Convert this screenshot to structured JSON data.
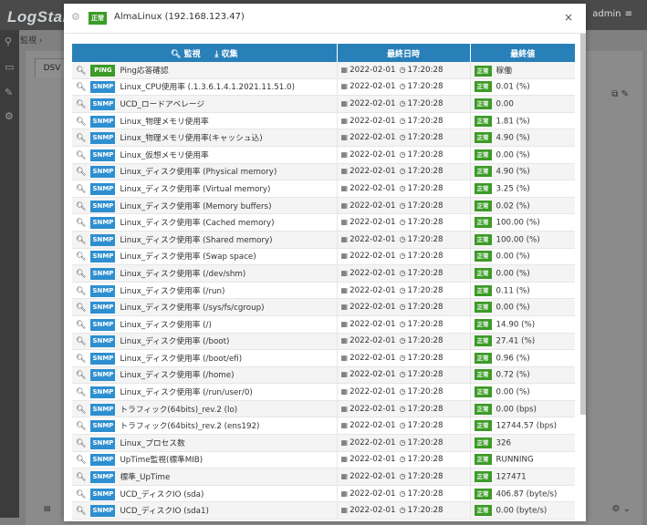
{
  "app": {
    "logo": "LogStar",
    "user": "admin",
    "breadcrumb": "監視 ›",
    "tab": "DSV"
  },
  "modal": {
    "status_badge": "正常",
    "title": "AlmaLinux (192.168.123.47)",
    "close": "×",
    "columns": {
      "monitor": "監視",
      "collect": "収集",
      "last_time": "最終日時",
      "last_value": "最終値"
    },
    "rows": [
      {
        "type": "PING",
        "name": "Ping応答確認",
        "date": "2022-02-01",
        "time": "17:20:28",
        "status": "正常",
        "value": "稼働"
      },
      {
        "type": "SNMP",
        "name": "Linux_CPU使用率 (.1.3.6.1.4.1.2021.11.51.0)",
        "date": "2022-02-01",
        "time": "17:20:28",
        "status": "正常",
        "value": "0.01 (%)"
      },
      {
        "type": "SNMP",
        "name": "UCD_ロードアベレージ",
        "date": "2022-02-01",
        "time": "17:20:28",
        "status": "正常",
        "value": "0.00"
      },
      {
        "type": "SNMP",
        "name": "Linux_物理メモリ使用率",
        "date": "2022-02-01",
        "time": "17:20:28",
        "status": "正常",
        "value": "1.81 (%)"
      },
      {
        "type": "SNMP",
        "name": "Linux_物理メモリ使用率(キャッシュ込)",
        "date": "2022-02-01",
        "time": "17:20:28",
        "status": "正常",
        "value": "4.90 (%)"
      },
      {
        "type": "SNMP",
        "name": "Linux_仮想メモリ使用率",
        "date": "2022-02-01",
        "time": "17:20:28",
        "status": "正常",
        "value": "0.00 (%)"
      },
      {
        "type": "SNMP",
        "name": "Linux_ディスク使用率 (Physical memory)",
        "date": "2022-02-01",
        "time": "17:20:28",
        "status": "正常",
        "value": "4.90 (%)"
      },
      {
        "type": "SNMP",
        "name": "Linux_ディスク使用率 (Virtual memory)",
        "date": "2022-02-01",
        "time": "17:20:28",
        "status": "正常",
        "value": "3.25 (%)"
      },
      {
        "type": "SNMP",
        "name": "Linux_ディスク使用率 (Memory buffers)",
        "date": "2022-02-01",
        "time": "17:20:28",
        "status": "正常",
        "value": "0.02 (%)"
      },
      {
        "type": "SNMP",
        "name": "Linux_ディスク使用率 (Cached memory)",
        "date": "2022-02-01",
        "time": "17:20:28",
        "status": "正常",
        "value": "100.00 (%)"
      },
      {
        "type": "SNMP",
        "name": "Linux_ディスク使用率 (Shared memory)",
        "date": "2022-02-01",
        "time": "17:20:28",
        "status": "正常",
        "value": "100.00 (%)"
      },
      {
        "type": "SNMP",
        "name": "Linux_ディスク使用率 (Swap space)",
        "date": "2022-02-01",
        "time": "17:20:28",
        "status": "正常",
        "value": "0.00 (%)"
      },
      {
        "type": "SNMP",
        "name": "Linux_ディスク使用率 (/dev/shm)",
        "date": "2022-02-01",
        "time": "17:20:28",
        "status": "正常",
        "value": "0.00 (%)"
      },
      {
        "type": "SNMP",
        "name": "Linux_ディスク使用率 (/run)",
        "date": "2022-02-01",
        "time": "17:20:28",
        "status": "正常",
        "value": "0.11 (%)"
      },
      {
        "type": "SNMP",
        "name": "Linux_ディスク使用率 (/sys/fs/cgroup)",
        "date": "2022-02-01",
        "time": "17:20:28",
        "status": "正常",
        "value": "0.00 (%)"
      },
      {
        "type": "SNMP",
        "name": "Linux_ディスク使用率 (/)",
        "date": "2022-02-01",
        "time": "17:20:28",
        "status": "正常",
        "value": "14.90 (%)"
      },
      {
        "type": "SNMP",
        "name": "Linux_ディスク使用率 (/boot)",
        "date": "2022-02-01",
        "time": "17:20:28",
        "status": "正常",
        "value": "27.41 (%)"
      },
      {
        "type": "SNMP",
        "name": "Linux_ディスク使用率 (/boot/efi)",
        "date": "2022-02-01",
        "time": "17:20:28",
        "status": "正常",
        "value": "0.96 (%)"
      },
      {
        "type": "SNMP",
        "name": "Linux_ディスク使用率 (/home)",
        "date": "2022-02-01",
        "time": "17:20:28",
        "status": "正常",
        "value": "0.72 (%)"
      },
      {
        "type": "SNMP",
        "name": "Linux_ディスク使用率 (/run/user/0)",
        "date": "2022-02-01",
        "time": "17:20:28",
        "status": "正常",
        "value": "0.00 (%)"
      },
      {
        "type": "SNMP",
        "name": "トラフィック(64bits)_rev.2 (lo)",
        "date": "2022-02-01",
        "time": "17:20:28",
        "status": "正常",
        "value": "0.00 (bps)"
      },
      {
        "type": "SNMP",
        "name": "トラフィック(64bits)_rev.2 (ens192)",
        "date": "2022-02-01",
        "time": "17:20:28",
        "status": "正常",
        "value": "12744.57 (bps)"
      },
      {
        "type": "SNMP",
        "name": "Linux_プロセス数",
        "date": "2022-02-01",
        "time": "17:20:28",
        "status": "正常",
        "value": "326"
      },
      {
        "type": "SNMP",
        "name": "UpTime監視(標準MIB)",
        "date": "2022-02-01",
        "time": "17:20:28",
        "status": "正常",
        "value": "RUNNING"
      },
      {
        "type": "SNMP",
        "name": "標準_UpTime",
        "date": "2022-02-01",
        "time": "17:20:28",
        "status": "正常",
        "value": "127471"
      },
      {
        "type": "SNMP",
        "name": "UCD_ディスクIO (sda)",
        "date": "2022-02-01",
        "time": "17:20:28",
        "status": "正常",
        "value": "406.87 (byte/s)"
      },
      {
        "type": "SNMP",
        "name": "UCD_ディスクIO (sda1)",
        "date": "2022-02-01",
        "time": "17:20:28",
        "status": "正常",
        "value": "0.00 (byte/s)"
      }
    ]
  },
  "colors": {
    "header": "#2980b9",
    "ok": "#3c9b27",
    "snmp": "#2e8fd0"
  }
}
